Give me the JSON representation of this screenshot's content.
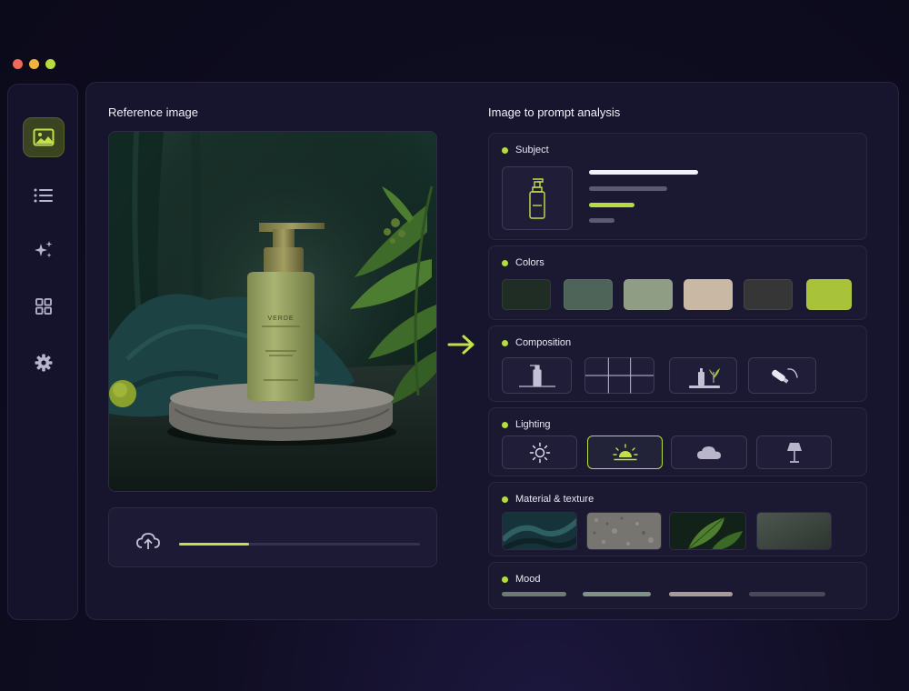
{
  "window": {
    "dots": [
      {
        "name": "close",
        "color": "#ef6a5a"
      },
      {
        "name": "minimize",
        "color": "#f0b33e"
      },
      {
        "name": "maximize",
        "color": "#b6dc3f"
      }
    ]
  },
  "sidebar": {
    "items": [
      {
        "icon": "image-icon",
        "active": true
      },
      {
        "icon": "list-icon",
        "active": false
      },
      {
        "icon": "sparkle-icon",
        "active": false
      },
      {
        "icon": "grid-icon",
        "active": false
      },
      {
        "icon": "gear-icon",
        "active": false
      }
    ]
  },
  "reference": {
    "title": "Reference image",
    "bottle_brand": "VERDE",
    "upload_icon": "cloud-upload-icon",
    "upload_progress": 0.29
  },
  "analysis": {
    "title": "Image to prompt analysis",
    "accent": "#b6dc3f",
    "sections": {
      "subject": {
        "label": "Subject",
        "icon": "bottle-icon"
      },
      "colors": {
        "label": "Colors",
        "swatches": [
          "#1f2d24",
          "#4e6458",
          "#8e9d84",
          "#c8b8a4",
          "#363636",
          "#a8c23a"
        ]
      },
      "composition": {
        "label": "Composition",
        "options": [
          "centered-product-icon",
          "rule-of-thirds-grid-icon",
          "product-with-plant-icon",
          "angled-view-icon"
        ]
      },
      "lighting": {
        "label": "Lighting",
        "options": [
          "sun-icon",
          "sunrise-icon",
          "cloud-icon",
          "lamp-icon"
        ],
        "selected": "sunrise-icon"
      },
      "material": {
        "label": "Material & texture",
        "textures": [
          "velvet-fabric",
          "stone-surface",
          "green-leaves",
          "matte-green-plastic"
        ]
      },
      "mood": {
        "label": "Mood",
        "bar_colors": [
          "#6e7a74",
          "#7f9284",
          "#a89c98",
          "#4a4858"
        ]
      }
    }
  }
}
